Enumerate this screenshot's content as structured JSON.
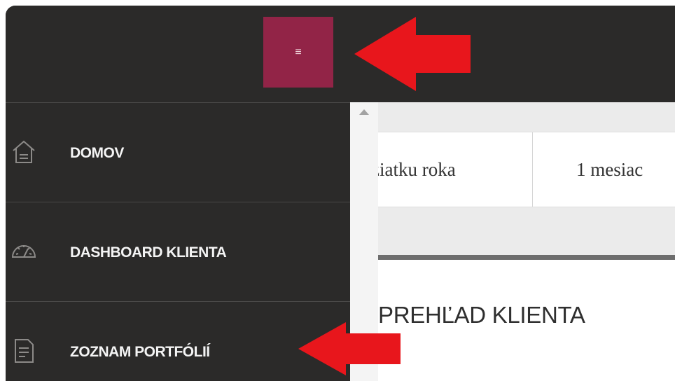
{
  "topbar": {
    "menu_button_glyph": "≡",
    "menu_button_color": "#922447",
    "background_color": "#2b2a29"
  },
  "sidebar": {
    "items": [
      {
        "label": "DOMOV",
        "icon": "home-icon"
      },
      {
        "label": "DASHBOARD KLIENTA",
        "icon": "speedometer-icon"
      },
      {
        "label": "ZOZNAM PORTFÓLIÍ",
        "icon": "document-icon"
      }
    ]
  },
  "content": {
    "periods": [
      "ziatku roka",
      "1 mesiac"
    ],
    "panel_title": "PREHĽAD KLIENTA"
  },
  "annotations": {
    "arrow_color": "#e8161c"
  }
}
